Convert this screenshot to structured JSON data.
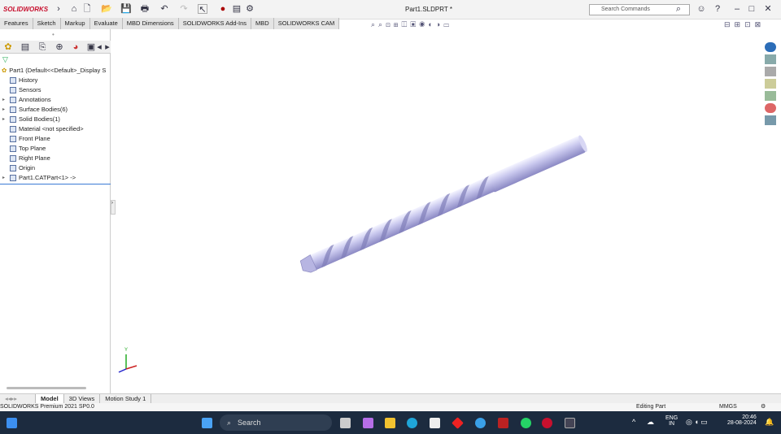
{
  "app": {
    "logo": "SOLIDWORKS",
    "doc_title": "Part1.SLDPRT *",
    "search_placeholder": "Search Commands"
  },
  "command_tabs": [
    "Features",
    "Sketch",
    "Markup",
    "Evaluate",
    "MBD Dimensions",
    "SOLIDWORKS Add-Ins",
    "MBD",
    "SOLIDWORKS CAM"
  ],
  "tree": {
    "root": "Part1  (Default<<Default>_Display S",
    "items": [
      {
        "label": "History",
        "expandable": false
      },
      {
        "label": "Sensors",
        "expandable": false
      },
      {
        "label": "Annotations",
        "expandable": true
      },
      {
        "label": "Surface Bodies(6)",
        "expandable": true
      },
      {
        "label": "Solid Bodies(1)",
        "expandable": true
      },
      {
        "label": "Material <not specified>",
        "expandable": false
      },
      {
        "label": "Front Plane",
        "expandable": false
      },
      {
        "label": "Top Plane",
        "expandable": false
      },
      {
        "label": "Right Plane",
        "expandable": false
      },
      {
        "label": "Origin",
        "expandable": false
      },
      {
        "label": "Part1.CATPart<1> ->",
        "expandable": true
      }
    ]
  },
  "bottom_tabs": [
    "Model",
    "3D Views",
    "Motion Study 1"
  ],
  "status": {
    "version": "SOLIDWORKS Premium 2021 SP0.0",
    "mode": "Editing Part",
    "units": "MMGS"
  },
  "taskbar": {
    "search": "Search",
    "lang": "ENG",
    "region": "IN",
    "time": "20:46",
    "date": "28-08-2024"
  },
  "axis": {
    "y": "Y"
  }
}
